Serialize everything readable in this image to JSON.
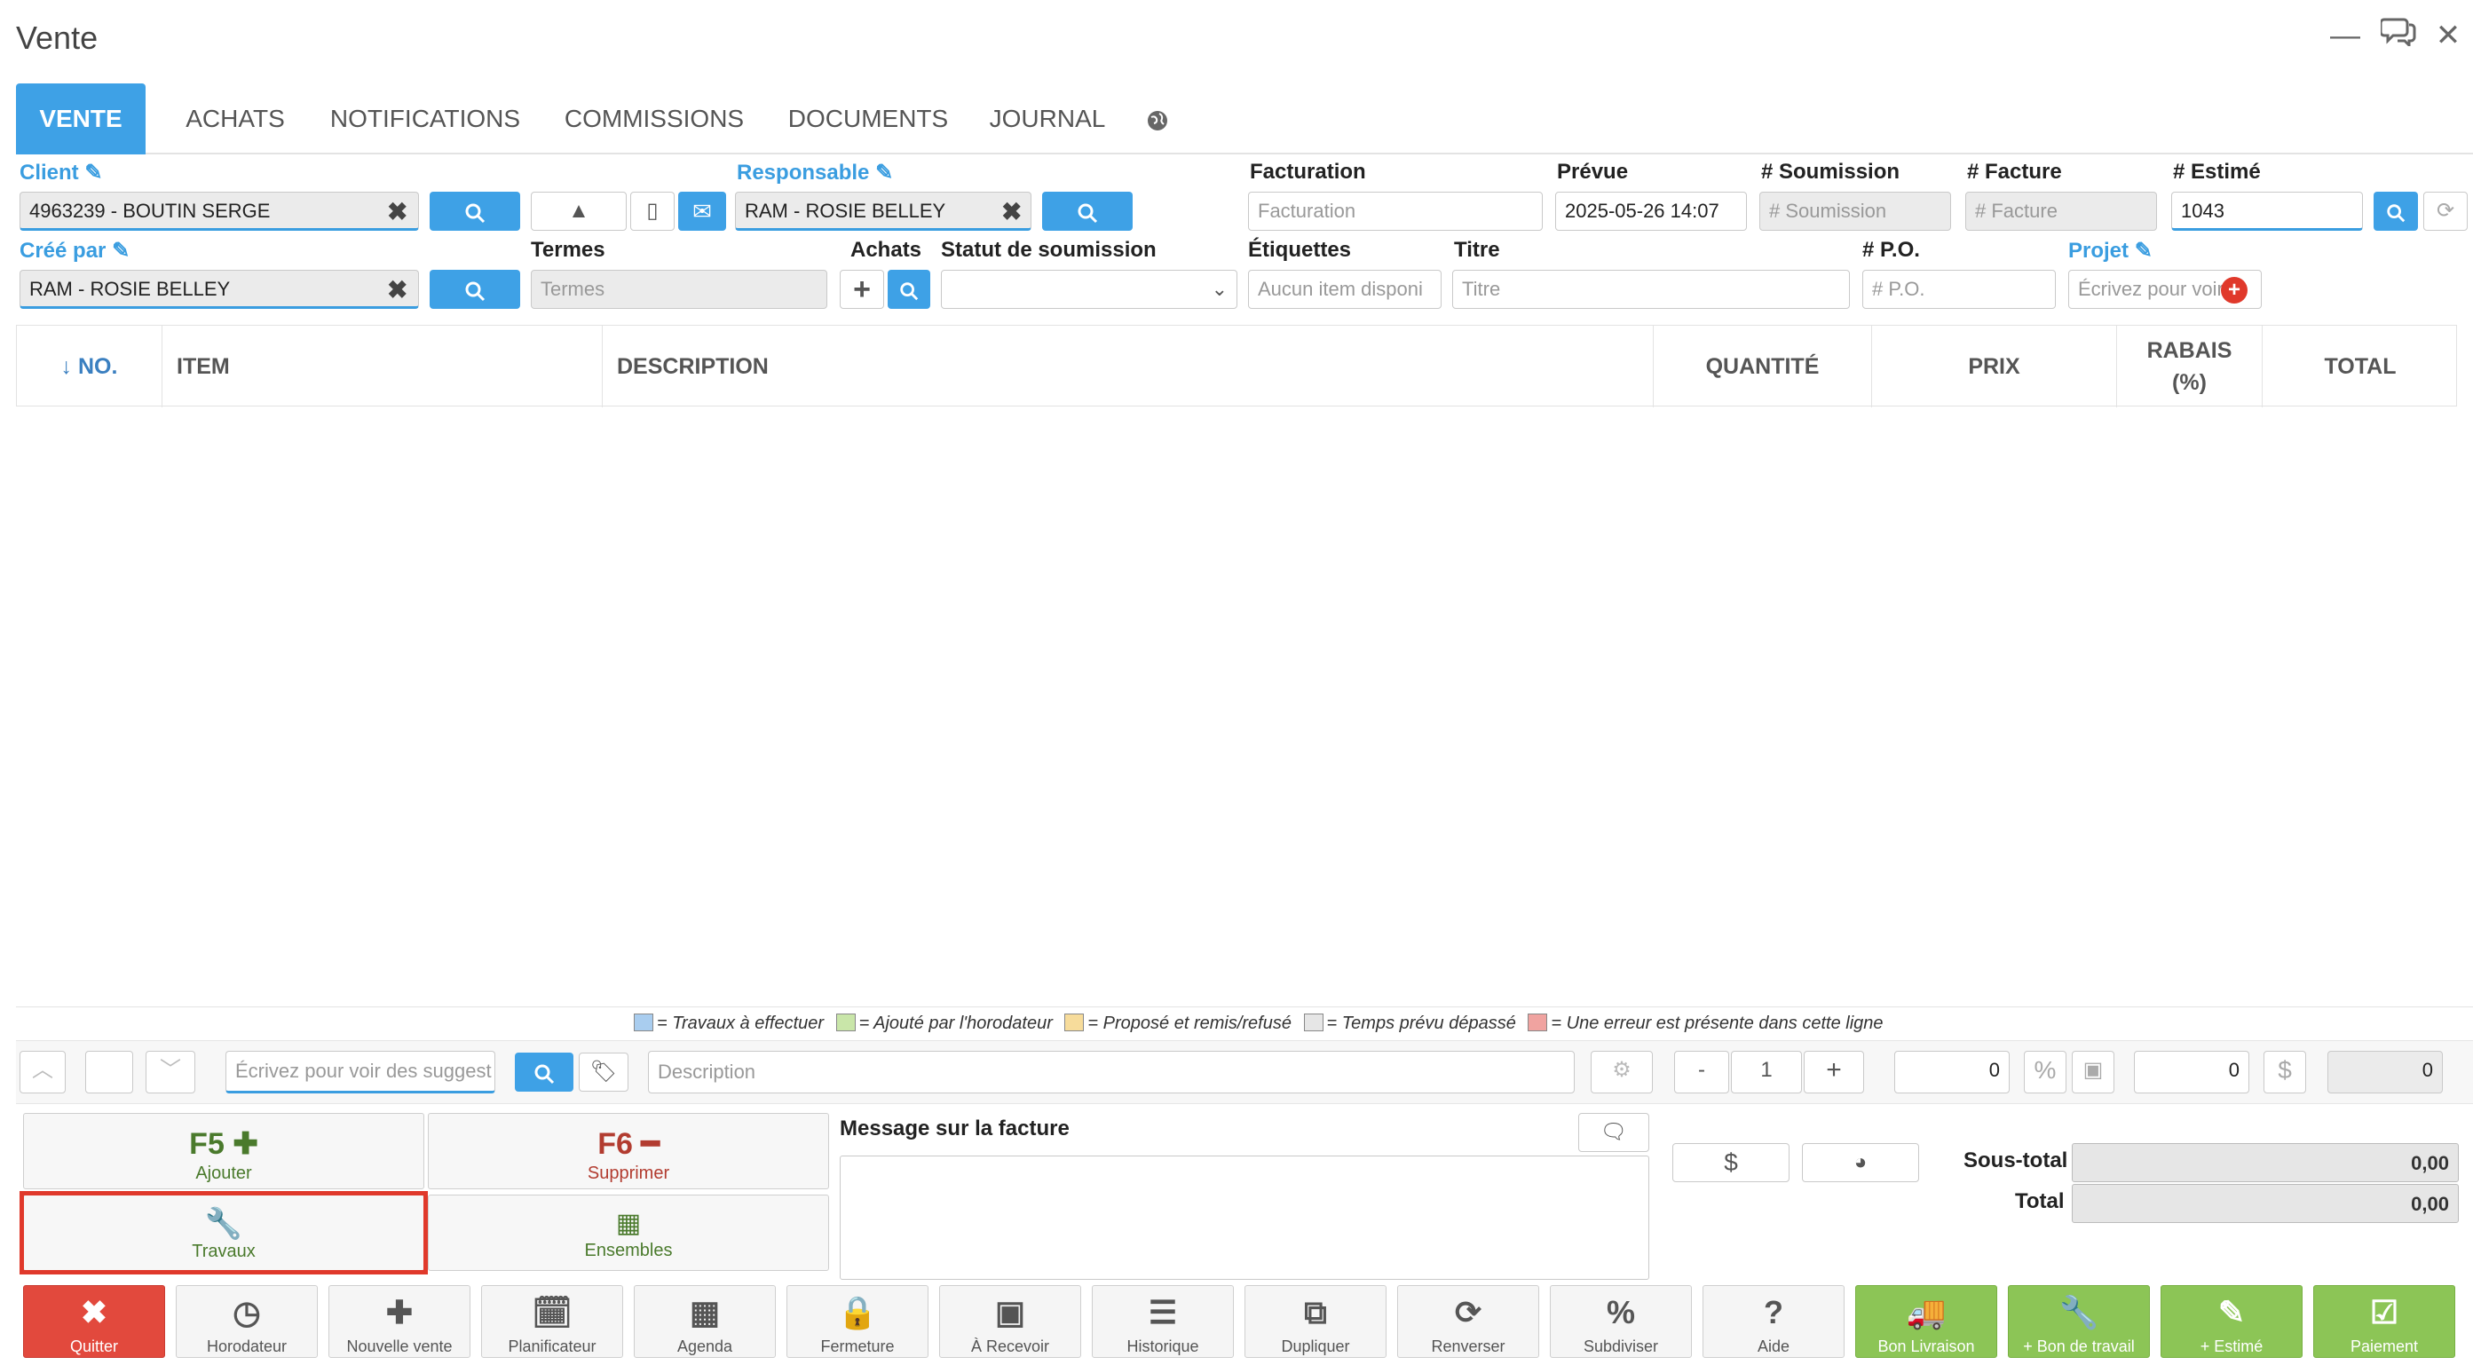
{
  "window": {
    "title": "Vente"
  },
  "tabs": [
    {
      "label": "VENTE",
      "active": true
    },
    {
      "label": "ACHATS"
    },
    {
      "label": "NOTIFICATIONS"
    },
    {
      "label": "COMMISSIONS"
    },
    {
      "label": "DOCUMENTS"
    },
    {
      "label": "JOURNAL"
    }
  ],
  "form": {
    "client_label": "Client",
    "client_value": "4963239 - BOUTIN SERGE",
    "responsable_label": "Responsable",
    "responsable_value": "RAM - ROSIE BELLEY",
    "facturation_label": "Facturation",
    "facturation_placeholder": "Facturation",
    "prevue_label": "Prévue",
    "prevue_value": "2025-05-26 14:07",
    "soumission_label": "# Soumission",
    "soumission_placeholder": "# Soumission",
    "facture_label": "# Facture",
    "facture_placeholder": "# Facture",
    "estime_label": "# Estimé",
    "estime_value": "1043",
    "cree_par_label": "Créé par",
    "cree_par_value": "RAM - ROSIE BELLEY",
    "termes_label": "Termes",
    "termes_placeholder": "Termes",
    "achats_label": "Achats",
    "statut_label": "Statut de soumission",
    "statut_value": "",
    "etiquettes_label": "Étiquettes",
    "etiquettes_placeholder": "Aucun item disponi",
    "titre_label": "Titre",
    "titre_placeholder": "Titre",
    "po_label": "# P.O.",
    "po_placeholder": "# P.O.",
    "projet_label": "Projet",
    "projet_placeholder": "Écrivez pour voir"
  },
  "table": {
    "headers": {
      "no": "↓ NO.",
      "item": "ITEM",
      "description": "DESCRIPTION",
      "quantite": "QUANTITÉ",
      "prix": "PRIX",
      "rabais_line1": "RABAIS",
      "rabais_line2": "(%)",
      "total": "TOTAL"
    },
    "rows": []
  },
  "legend": [
    {
      "text": "= Travaux à effectuer",
      "color": "#a9cdef"
    },
    {
      "text": "= Ajouté par l'horodateur",
      "color": "#c9e6a9"
    },
    {
      "text": "= Proposé et remis/refusé",
      "color": "#f7dc9b"
    },
    {
      "text": "= Temps prévu dépassé",
      "color": "#e6e6e6"
    },
    {
      "text": "= Une erreur est présente dans cette ligne",
      "color": "#f0a3a0"
    }
  ],
  "entry": {
    "item_placeholder": "Écrivez pour voir des suggest",
    "description_placeholder": "Description",
    "quantity_minus": "-",
    "quantity": "1",
    "quantity_plus": "+",
    "price": "0",
    "percent_symbol": "%",
    "discount": "0",
    "dollar_symbol": "$",
    "line_total": "0"
  },
  "actions": {
    "add_key": "F5",
    "add_label": "Ajouter",
    "delete_key": "F6",
    "delete_label": "Supprimer",
    "travaux_label": "Travaux",
    "ensembles_label": "Ensembles"
  },
  "message": {
    "label": "Message sur la facture",
    "value": ""
  },
  "totals": {
    "dollar_symbol": "$",
    "subtotal_label": "Sous-total",
    "subtotal_value": "0,00",
    "total_label": "Total",
    "total_value": "0,00"
  },
  "bottom_buttons": [
    {
      "label": "Quitter",
      "icon": "close-icon",
      "style": "red"
    },
    {
      "label": "Horodateur",
      "icon": "clock-icon"
    },
    {
      "label": "Nouvelle vente",
      "icon": "plus-icon"
    },
    {
      "label": "Planificateur",
      "icon": "calendar-plus-icon"
    },
    {
      "label": "Agenda",
      "icon": "calendar-icon"
    },
    {
      "label": "Fermeture",
      "icon": "lock-icon"
    },
    {
      "label": "À Recevoir",
      "icon": "money-icon"
    },
    {
      "label": "Historique",
      "icon": "list-icon"
    },
    {
      "label": "Dupliquer",
      "icon": "copy-icon"
    },
    {
      "label": "Renverser",
      "icon": "refresh-icon"
    },
    {
      "label": "Subdiviser",
      "icon": "percent-icon"
    },
    {
      "label": "Aide",
      "icon": "question-icon"
    },
    {
      "label": "Bon Livraison",
      "icon": "truck-icon",
      "style": "green"
    },
    {
      "label": "+ Bon de travail",
      "icon": "wrench-icon",
      "style": "green"
    },
    {
      "label": "+ Estimé",
      "icon": "edit-icon",
      "style": "green"
    },
    {
      "label": "Paiement",
      "icon": "check-icon",
      "style": "green"
    }
  ],
  "colors": {
    "accent": "#3ea1e6",
    "danger": "#e2493d",
    "success": "#8cc556",
    "highlight": "#e0392b"
  }
}
